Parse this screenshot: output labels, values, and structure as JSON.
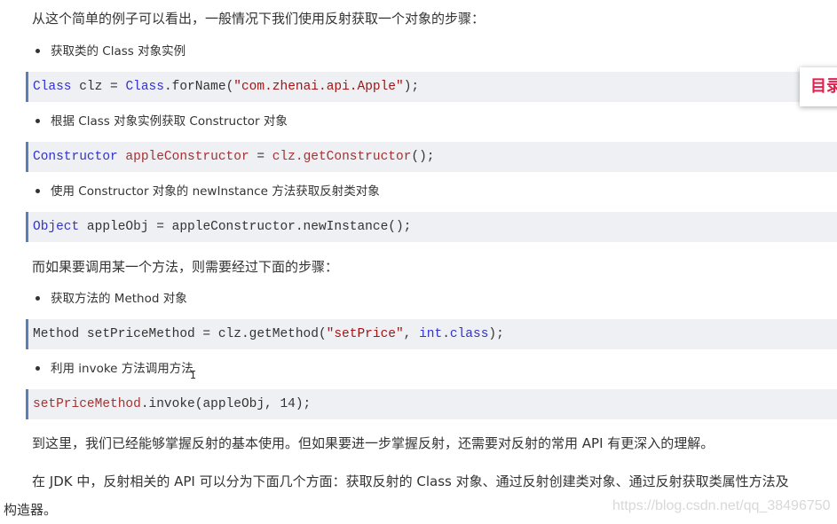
{
  "paragraphs": {
    "intro": "从这个简单的例子可以看出，一般情况下我们使用反射获取一个对象的步骤：",
    "method_intro": "而如果要调用某一个方法，则需要经过下面的步骤：",
    "summary": "到这里，我们已经能够掌握反射的基本使用。但如果要进一步掌握反射，还需要对反射的常用 API 有更深入的理解。",
    "api_line1": "在 JDK 中，反射相关的 API 可以分为下面几个方面：获取反射的 Class 对象、通过反射创建类对象、通过反射获取类属性方法及",
    "api_line2": "构造器。"
  },
  "bullets": [
    "获取类的 Class 对象实例",
    "根据 Class 对象实例获取 Constructor 对象",
    "使用 Constructor 对象的 newInstance 方法获取反射类对象",
    "获取方法的 Method 对象",
    "利用 invoke 方法调用方法"
  ],
  "code": [
    {
      "tokens": [
        {
          "t": "Class",
          "c": "kw"
        },
        {
          "t": " clz = ",
          "c": ""
        },
        {
          "t": "Class",
          "c": "kw"
        },
        {
          "t": ".forName(",
          "c": ""
        },
        {
          "t": "\"com.zhenai.api.Apple\"",
          "c": "str"
        },
        {
          "t": ");",
          "c": ""
        }
      ]
    },
    {
      "tokens": [
        {
          "t": "Constructor",
          "c": "kw"
        },
        {
          "t": " ",
          "c": ""
        },
        {
          "t": "appleConstructor",
          "c": "var"
        },
        {
          "t": " = ",
          "c": ""
        },
        {
          "t": "clz.getConstructor",
          "c": "var"
        },
        {
          "t": "();",
          "c": ""
        }
      ]
    },
    {
      "tokens": [
        {
          "t": "Object",
          "c": "kw"
        },
        {
          "t": " appleObj = appleConstructor.newInstance();",
          "c": ""
        }
      ]
    },
    {
      "tokens": [
        {
          "t": "Method setPriceMethod = clz.getMethod(",
          "c": ""
        },
        {
          "t": "\"setPrice\"",
          "c": "str"
        },
        {
          "t": ", ",
          "c": ""
        },
        {
          "t": "int",
          "c": "kw"
        },
        {
          "t": ".",
          "c": ""
        },
        {
          "t": "class",
          "c": "kw"
        },
        {
          "t": ");",
          "c": ""
        }
      ]
    },
    {
      "tokens": [
        {
          "t": "setPriceMethod",
          "c": "var"
        },
        {
          "t": ".invoke(appleObj, 14);",
          "c": ""
        }
      ]
    }
  ],
  "toc_label": "目录",
  "watermark": "https://blog.csdn.net/qq_38496750"
}
